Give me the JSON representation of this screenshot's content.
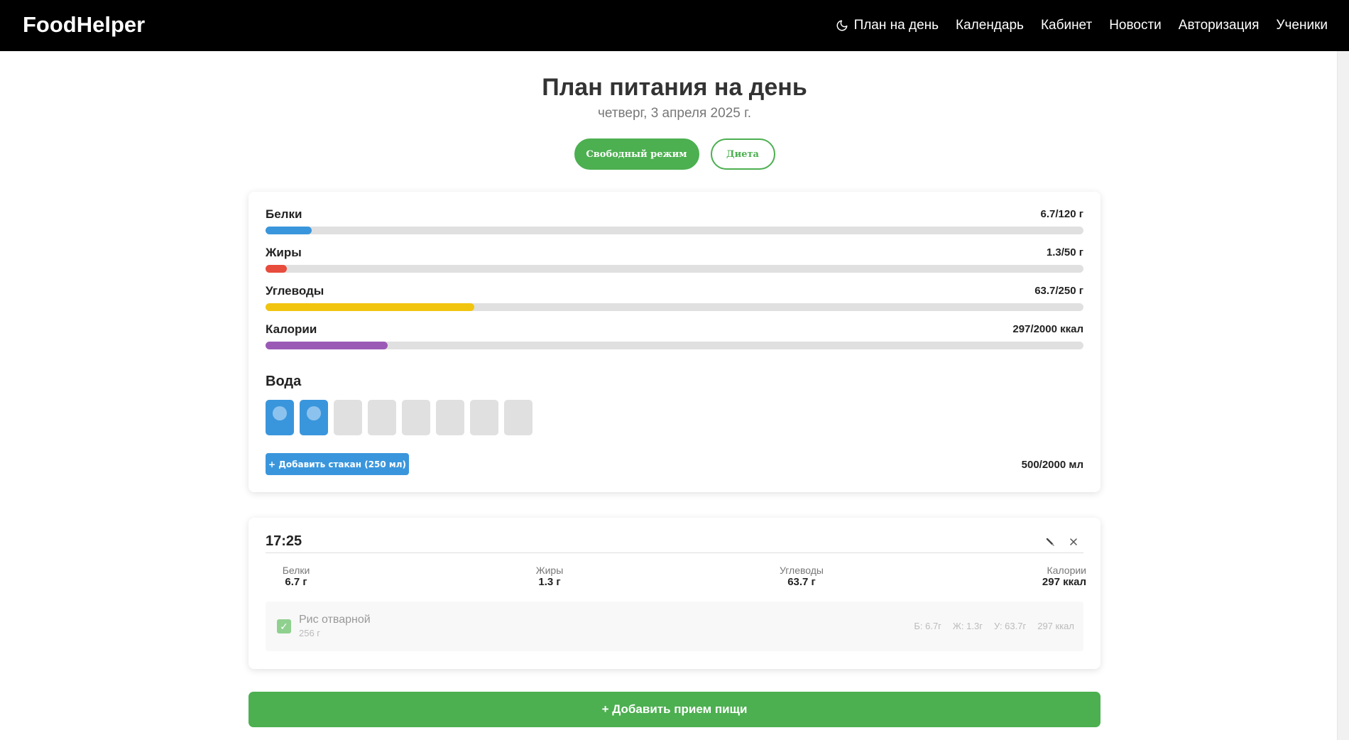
{
  "header": {
    "brand": "FoodHelper",
    "nav": {
      "plan": "План на день",
      "calendar": "Календарь",
      "cabinet": "Кабинет",
      "news": "Новости",
      "auth": "Авторизация",
      "students": "Ученики"
    },
    "theme_icon": "moon-icon"
  },
  "page": {
    "title": "План питания на день",
    "date": "четверг, 3 апреля 2025 г."
  },
  "modes": {
    "free": "Свободный режим",
    "diet": "Диета",
    "active": "free"
  },
  "macros": [
    {
      "label": "Белки",
      "value": "6.7/120 г",
      "progress": 0.056,
      "color": "#3a96dc"
    },
    {
      "label": "Жиры",
      "value": "1.3/50 г",
      "progress": 0.026,
      "color": "#e74c3c"
    },
    {
      "label": "Углеводы",
      "value": "63.7/250 г",
      "progress": 0.255,
      "color": "#f1c40f"
    },
    {
      "label": "Калории",
      "value": "297/2000 ккал",
      "progress": 0.149,
      "color": "#9b59b6"
    }
  ],
  "water": {
    "title": "Вода",
    "glasses_total": 8,
    "glasses_filled": 2,
    "add_button": "+ Добавить стакан (250 мл)",
    "total": "500/2000 мл"
  },
  "meal": {
    "time": "17:25",
    "edit_icon": "pencil-icon",
    "delete_icon": "close-icon",
    "stats": [
      {
        "label": "Белки",
        "value": "6.7 г"
      },
      {
        "label": "Жиры",
        "value": "1.3 г"
      },
      {
        "label": "Углеводы",
        "value": "63.7 г"
      },
      {
        "label": "Калории",
        "value": "297 ккал"
      }
    ],
    "food": {
      "name": "Рис отварной",
      "weight": "256 г",
      "checked": true,
      "protein": "Б: 6.7г",
      "fat": "Ж: 1.3г",
      "carbs": "У: 63.7г",
      "kcal": "297 ккал"
    }
  },
  "add_meal_button": "+ Добавить прием пищи"
}
